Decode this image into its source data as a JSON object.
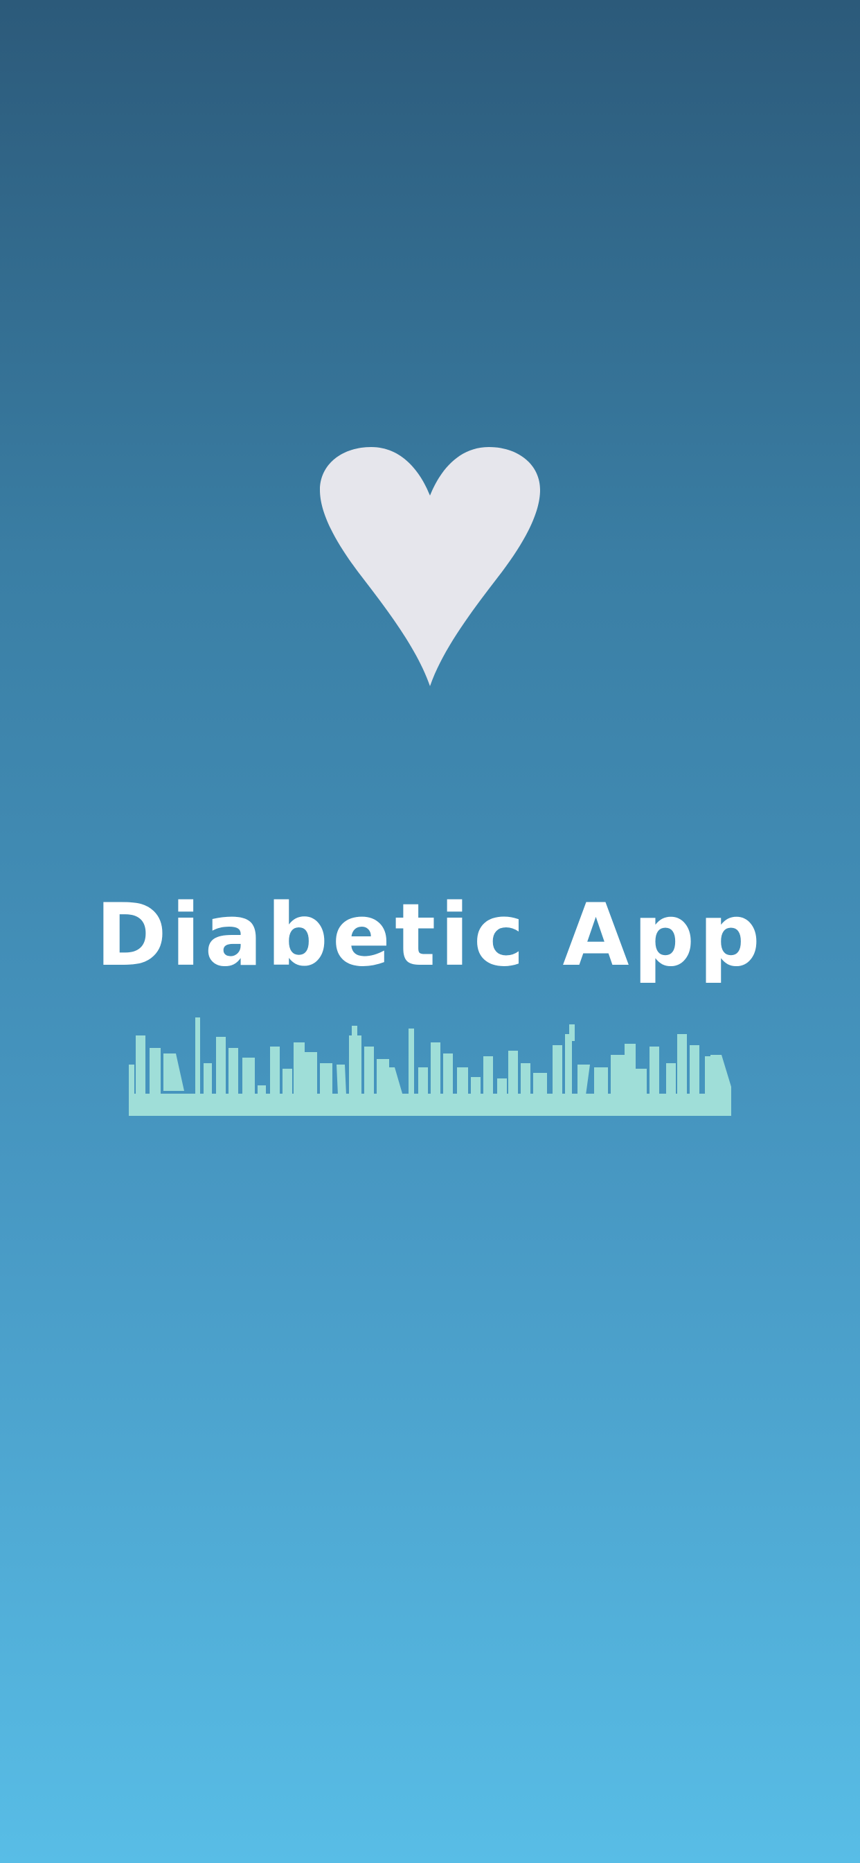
{
  "splash": {
    "app_name": "Diabetic App",
    "logo_icon": "heart-icon",
    "decoration_icon": "city-skyline-icon"
  },
  "colors": {
    "background_top": "#2c5a7a",
    "background_bottom": "#58bde6",
    "heart": "#e6e6ec",
    "title": "#ffffff",
    "skyline": "#9fded8"
  }
}
